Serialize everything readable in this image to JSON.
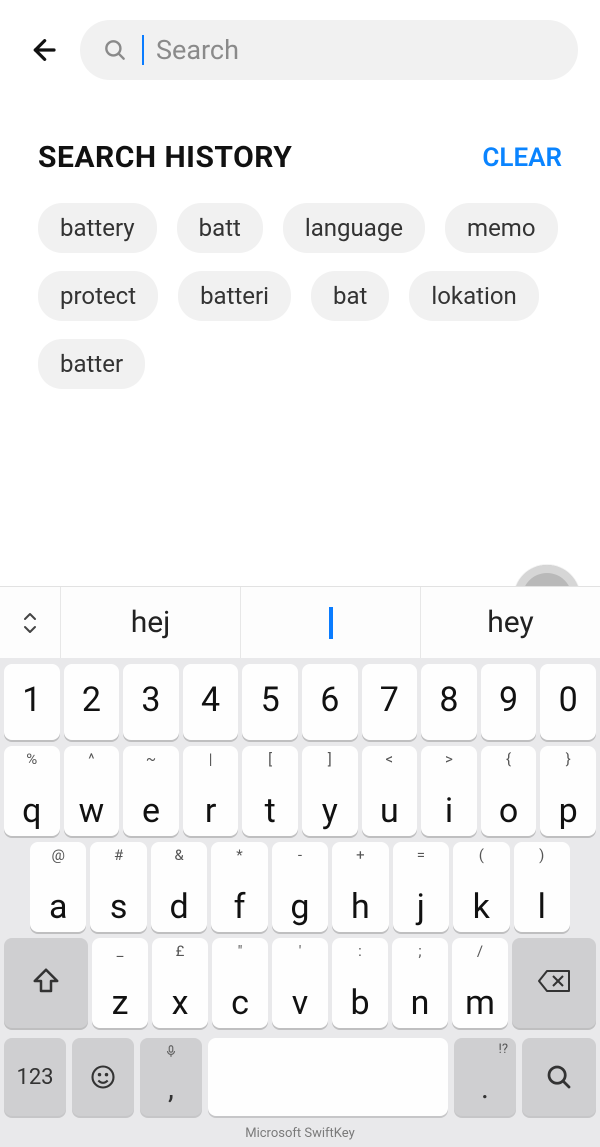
{
  "header": {
    "search_placeholder": "Search",
    "search_value": ""
  },
  "history": {
    "title": "SEARCH HISTORY",
    "clear_label": "CLEAR",
    "items": [
      "battery",
      "batt",
      "language",
      "memo",
      "protect",
      "batteri",
      "bat",
      "lokation",
      "batter"
    ]
  },
  "suggestions": {
    "left": "hej",
    "center": "",
    "right": "hey"
  },
  "keyboard": {
    "row_num": [
      "1",
      "2",
      "3",
      "4",
      "5",
      "6",
      "7",
      "8",
      "9",
      "0"
    ],
    "row1_alt": [
      "%",
      "^",
      "~",
      "|",
      "[",
      "]",
      "<",
      ">",
      "{",
      "}"
    ],
    "row1": [
      "q",
      "w",
      "e",
      "r",
      "t",
      "y",
      "u",
      "i",
      "o",
      "p"
    ],
    "row2_alt": [
      "@",
      "#",
      "&",
      "*",
      "-",
      "+",
      "=",
      "(",
      ")"
    ],
    "row2": [
      "a",
      "s",
      "d",
      "f",
      "g",
      "h",
      "j",
      "k",
      "l"
    ],
    "row3_alt": [
      "_",
      "£",
      "\"",
      "'",
      ":",
      ";",
      "/"
    ],
    "row3": [
      "z",
      "x",
      "c",
      "v",
      "b",
      "n",
      "m"
    ],
    "bottom": {
      "sym": "123",
      "comma": ",",
      "dot": ".",
      "dot_alt": "!?"
    },
    "brand": "Microsoft SwiftKey"
  }
}
